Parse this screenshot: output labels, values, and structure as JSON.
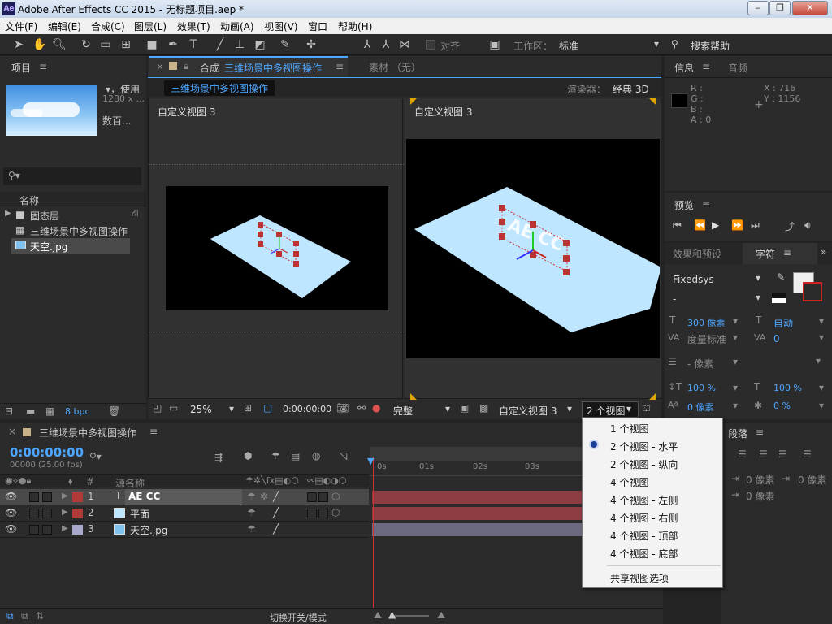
{
  "window": {
    "app_icon": "Ae",
    "title": "Adobe After Effects CC 2015 - 无标题项目.aep *",
    "minimize": "‒",
    "maximize": "❐",
    "close": "✕"
  },
  "menu": [
    "文件(F)",
    "编辑(E)",
    "合成(C)",
    "图层(L)",
    "效果(T)",
    "动画(A)",
    "视图(V)",
    "窗口",
    "帮助(H)"
  ],
  "toolbar": {
    "snap_label": "对齐",
    "workspace_label": "工作区：",
    "workspace_value": "标准",
    "search_help": "搜索帮助"
  },
  "project": {
    "tab": "项目",
    "thumb_used": "▾，使用",
    "thumb_size": "1280 x ...",
    "thumb_count": "数百...",
    "col_name": "名称",
    "items": [
      "固态层",
      "三维场景中多视图操作",
      "天空.jpg"
    ],
    "bpc": "8 bpc"
  },
  "composition": {
    "tab_prefix": "合成",
    "tab_name": "三维场景中多视图操作",
    "footage_tab": "素材 （无）",
    "comp_label": "三维场景中多视图操作",
    "renderer_label": "渲染器：",
    "renderer_value": "经典 3D",
    "left_view_label": "自定义视图 3",
    "right_view_label": "自定义视图 3",
    "zoom": "25%",
    "timecode": "0:00:00:00",
    "quality": "完整",
    "view_select": "自定义视图 3",
    "views_select": "2 个视图"
  },
  "view_dropdown": {
    "items": [
      "1 个视图",
      "2 个视图 - 水平",
      "2 个视图 - 纵向",
      "4 个视图",
      "4 个视图 - 左侧",
      "4 个视图 - 右侧",
      "4 个视图 - 顶部",
      "4 个视图 - 底部"
    ],
    "selected": "2 个视图 - 水平",
    "share_option": "共享视图选项"
  },
  "info": {
    "tab": "信息",
    "audio_tab": "音频",
    "r": "R :",
    "g": "G :",
    "b": "B :",
    "a": "A : 0",
    "x": "X : 716",
    "y": "Y : 1156"
  },
  "preview": {
    "tab": "预览"
  },
  "character": {
    "effects_tab": "效果和预设",
    "tab": "字符",
    "font": "Fixedsys",
    "style": "-",
    "size": "300 像素",
    "leading": "自动",
    "kerning": "度量标准",
    "tracking": "0",
    "stroke": "- 像素",
    "vscale": "100 %",
    "hscale": "100 %",
    "baseline": "0 像素",
    "tsume": "0 %"
  },
  "paragraph": {
    "tab": "段落",
    "indent_left": "0 像素",
    "indent_right": "0 像素",
    "space_before": "0 像素"
  },
  "timeline": {
    "comp_name": "三维场景中多视图操作",
    "timecode": "0:00:00:00",
    "fps": "00000 (25.00 fps)",
    "col_hash": "#",
    "col_source": "源名称",
    "ruler": [
      "0s",
      "01s",
      "02s",
      "03s"
    ],
    "layers": [
      {
        "num": "1",
        "name": "AE CC",
        "color": "#b03a3a"
      },
      {
        "num": "2",
        "name": "平面",
        "color": "#b03a3a"
      },
      {
        "num": "3",
        "name": "天空.jpg",
        "color": "#a9a9cc"
      }
    ],
    "switch_mode": "切换开关/模式"
  },
  "colors": {
    "accent": "#4da6ff",
    "layer_bar_red": "#8e3d42",
    "layer_bar_lilac": "#6c6a80",
    "plane": "#bfe6ff"
  }
}
